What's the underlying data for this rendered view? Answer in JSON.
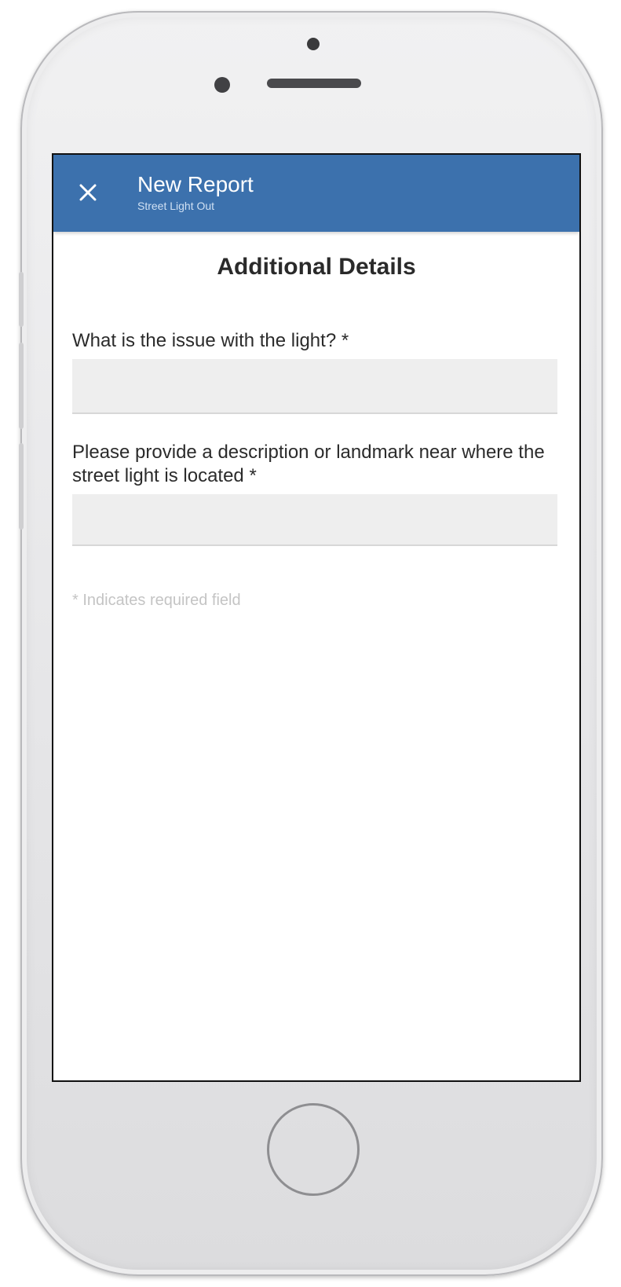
{
  "app_bar": {
    "title": "New Report",
    "subtitle": "Street Light Out",
    "close_icon": "close-icon",
    "background_color": "#3c71ad"
  },
  "section": {
    "title": "Additional Details"
  },
  "fields": [
    {
      "label": "What is the issue with the light? *",
      "value": ""
    },
    {
      "label": "Please provide a description or landmark near where the street light is located *",
      "value": ""
    }
  ],
  "footer_note": "* Indicates required field"
}
